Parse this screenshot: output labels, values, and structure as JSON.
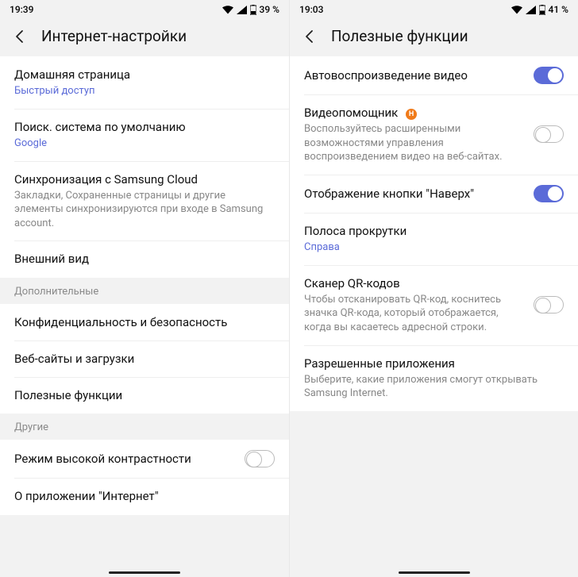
{
  "left": {
    "status": {
      "time": "19:39",
      "battery": "39 %"
    },
    "title": "Интернет-настройки",
    "items": [
      {
        "title": "Домашняя страница",
        "sub": "Быстрый доступ",
        "subLink": true
      },
      {
        "title": "Поиск. система по умолчанию",
        "sub": "Google",
        "subLink": true
      },
      {
        "title": "Синхронизация с Samsung Cloud",
        "sub": "Закладки, Сохраненные страницы и другие элементы синхронизируются при входе в Samsung account."
      },
      {
        "title": "Внешний вид"
      }
    ],
    "section2": "Дополнительные",
    "items2": [
      {
        "title": "Конфиденциальность и безопасность"
      },
      {
        "title": "Веб-сайты и загрузки"
      },
      {
        "title": "Полезные функции"
      }
    ],
    "section3": "Другие",
    "items3_contrast": "Режим высокой контрастности",
    "items3_about": "О приложении \"Интернет\""
  },
  "right": {
    "status": {
      "time": "19:03",
      "battery": "41 %"
    },
    "title": "Полезные функции",
    "autoplay": "Автовоспроизведение видео",
    "assistant_title": "Видеопомощник",
    "assistant_badge": "Н",
    "assistant_sub": "Воспользуйтесь расширенными возможностями управления воспроизведением видео на веб-сайтах.",
    "topbtn": "Отображение кнопки \"Наверх\"",
    "scroll_title": "Полоса прокрутки",
    "scroll_sub": "Справа",
    "qr_title": "Сканер QR-кодов",
    "qr_sub": "Чтобы отсканировать QR-код, коснитесь значка QR-кода, который отображается, когда вы касаетесь адресной строки.",
    "apps_title": "Разрешенные приложения",
    "apps_sub": "Выберите, какие приложения смогут открывать Samsung Internet."
  }
}
